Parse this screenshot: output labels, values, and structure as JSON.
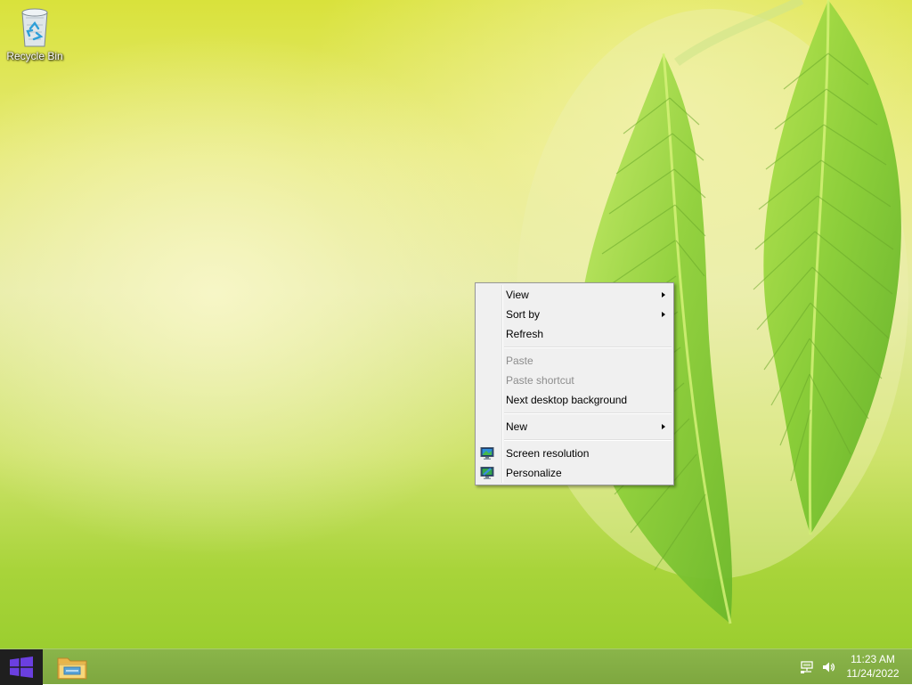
{
  "desktop": {
    "icons": [
      {
        "label": "Recycle Bin",
        "icon": "recycle-bin-icon"
      }
    ]
  },
  "context_menu": {
    "items": [
      {
        "label": "View",
        "submenu": true,
        "enabled": true
      },
      {
        "label": "Sort by",
        "submenu": true,
        "enabled": true
      },
      {
        "label": "Refresh",
        "submenu": false,
        "enabled": true
      },
      {
        "label": "Paste",
        "submenu": false,
        "enabled": false
      },
      {
        "label": "Paste shortcut",
        "submenu": false,
        "enabled": false
      },
      {
        "label": "Next desktop background",
        "submenu": false,
        "enabled": true
      },
      {
        "label": "New",
        "submenu": true,
        "enabled": true
      },
      {
        "label": "Screen resolution",
        "submenu": false,
        "enabled": true,
        "icon": "monitor-icon"
      },
      {
        "label": "Personalize",
        "submenu": false,
        "enabled": true,
        "icon": "personalize-icon"
      }
    ]
  },
  "taskbar": {
    "start_icon": "windows-logo-icon",
    "pinned": [
      {
        "name": "File Explorer",
        "icon": "folder-icon"
      }
    ],
    "tray": {
      "icons": [
        "network-icon",
        "speaker-icon"
      ],
      "time": "11:23 AM",
      "date": "11/24/2022"
    }
  },
  "colors": {
    "taskbar": "#7ea73f",
    "start_button": "#1f1f1f",
    "windows_logo": "#6b3fe0",
    "menu_background": "#f0f0f0",
    "menu_disabled_text": "#8d8d8d"
  }
}
